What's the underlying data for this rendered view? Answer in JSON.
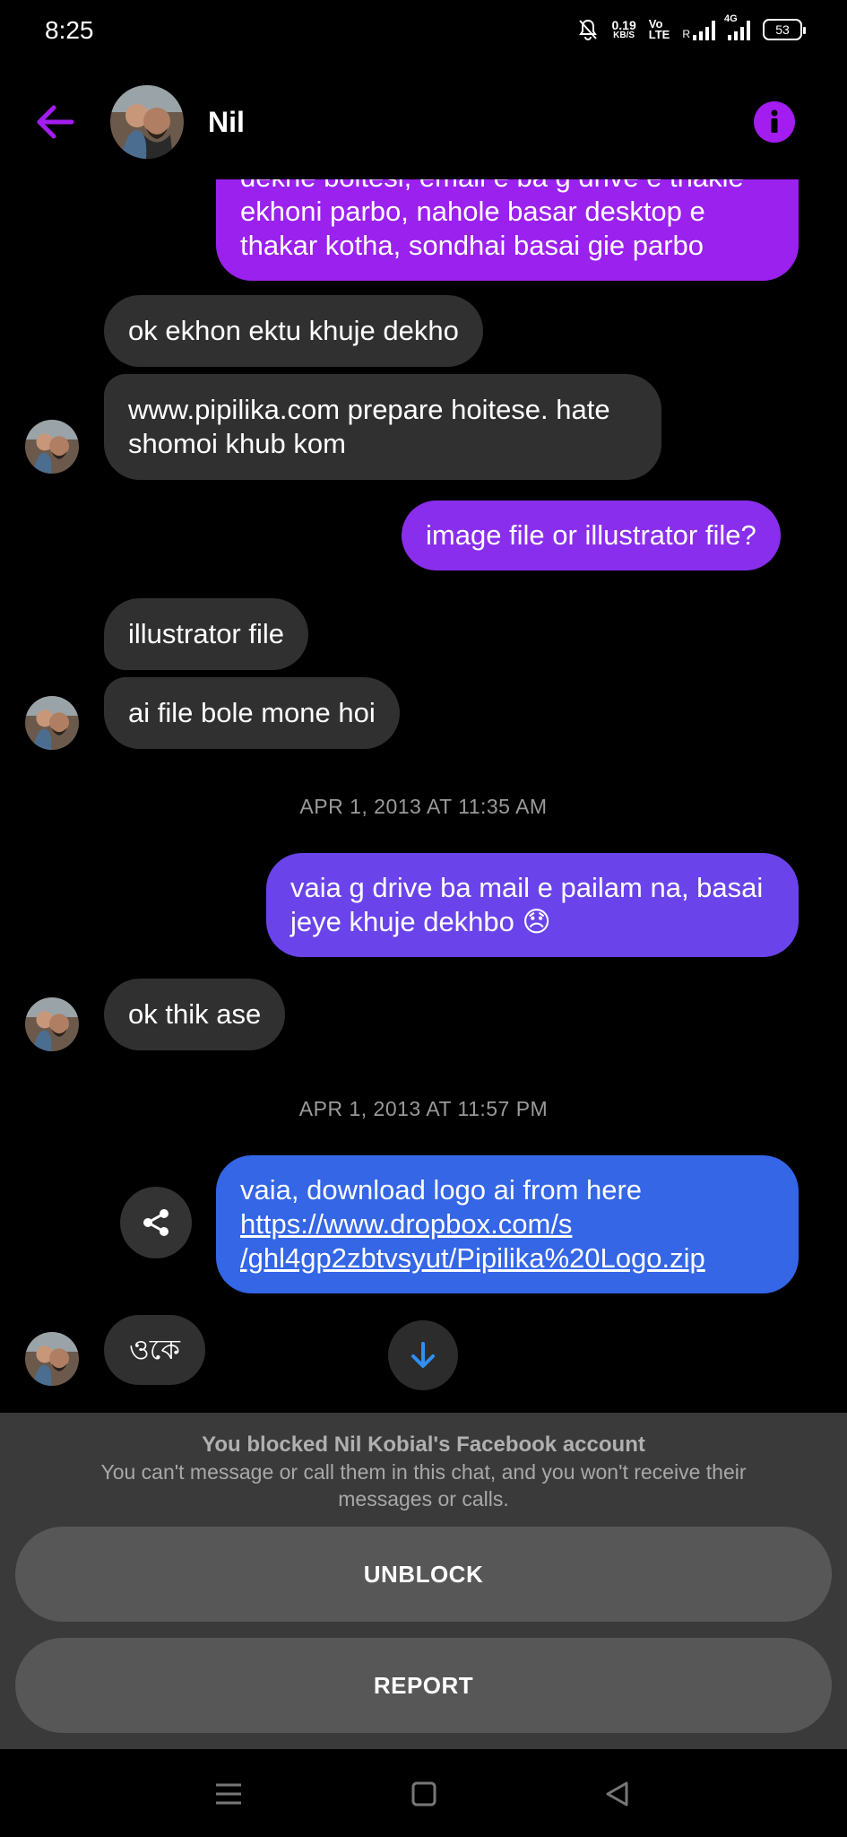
{
  "status_bar": {
    "time": "8:25",
    "net_speed_value": "0.19",
    "net_speed_unit": "KB/S",
    "volte_top": "Vo",
    "volte_bottom": "LTE",
    "sim1_label": "R",
    "network_type": "4G",
    "battery": "53"
  },
  "header": {
    "contact_name": "Nil",
    "icons": {
      "back": "back-arrow-icon",
      "info": "info-icon"
    }
  },
  "messages": [
    {
      "direction": "outgoing",
      "text": "dekhe boltesi, email e ba g drive e thakle ekhoni parbo, nahole basar desktop e thakar kotha, sondhai basai gie parbo"
    },
    {
      "direction": "incoming",
      "text": "ok ekhon ektu khuje dekho"
    },
    {
      "direction": "incoming",
      "text": "www.pipilika.com prepare hoitese. hate shomoi khub kom"
    },
    {
      "direction": "outgoing",
      "text": "image file or illustrator file?"
    },
    {
      "direction": "incoming",
      "text": "illustrator file"
    },
    {
      "direction": "incoming",
      "text": "ai file bole mone hoi"
    },
    {
      "direction": "timestamp",
      "text": "APR 1, 2013 AT 11:35 AM"
    },
    {
      "direction": "outgoing",
      "text": "vaia g drive ba mail e pailam na, basai jeye khuje dekhbo 😞"
    },
    {
      "direction": "incoming",
      "text": "ok thik ase"
    },
    {
      "direction": "timestamp",
      "text": "APR 1, 2013 AT 11:57 PM"
    },
    {
      "direction": "outgoing",
      "text": "vaia, download logo ai from here",
      "link": "https://www.dropbox.com/s/ghl4gp2zbtvsyut/Pipilika%20Logo.zip",
      "link_line1": "https://www.dropbox.com/s",
      "link_line2": "/ghl4gp2zbtvsyut/Pipilika%20Logo.zip"
    },
    {
      "direction": "incoming",
      "text": "ওকে"
    }
  ],
  "blocked": {
    "title": "You blocked Nil Kobial's Facebook account",
    "description": "You can't message or call them in this chat, and you won't receive their messages or calls.",
    "unblock_label": "UNBLOCK",
    "report_label": "REPORT"
  },
  "colors": {
    "accent": "#a31cf0",
    "outgoing_purple": "#9b21ee",
    "outgoing_violet": "#7a37ea",
    "outgoing_indigo": "#5a4ee8",
    "outgoing_blue": "#3466e6",
    "incoming_bg": "#303030",
    "scroll_arrow": "#2f8ff5"
  },
  "nav_bar": {
    "icons": [
      "menu-icon",
      "home-square-icon",
      "back-triangle-icon"
    ]
  }
}
